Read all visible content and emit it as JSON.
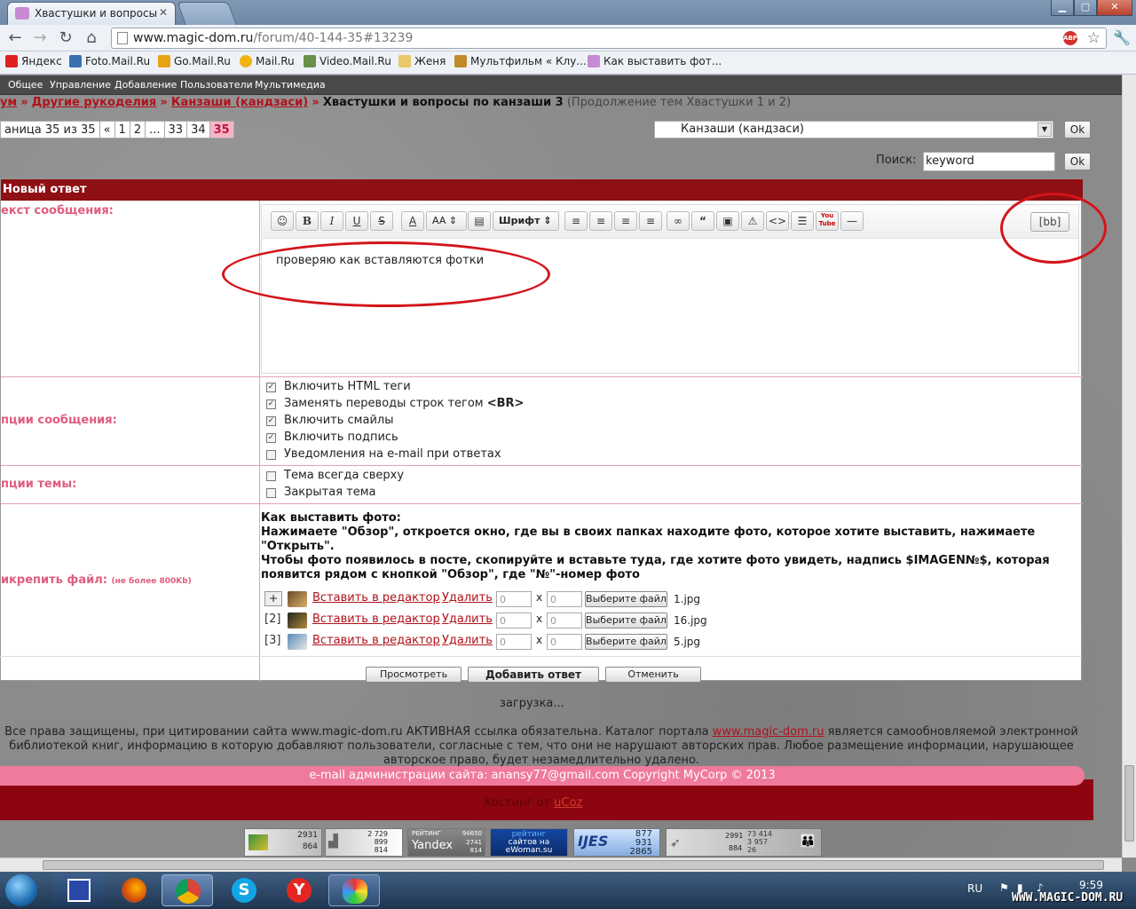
{
  "browser": {
    "tab_title": "Хвастушки и вопросы по",
    "url_host": "www.magic-dom.ru",
    "url_path": "/forum/40-144-35#13239",
    "abp_label": "ABP",
    "bookmarks": [
      "Яндекс",
      "Foto.Mail.Ru",
      "Go.Mail.Ru",
      "Mail.Ru",
      "Video.Mail.Ru",
      "Женя",
      "Мультфильм « Клу...",
      "Как выставить фот..."
    ]
  },
  "site_menu": [
    "Общее",
    "Управление",
    "Добавление",
    "Пользователи",
    "Мультимедиа"
  ],
  "breadcrumb": {
    "l1": "ум",
    "l2": "Другие рукоделия",
    "l3": "Канзаши (кандзаси)",
    "sep": "»",
    "current": "Хвастушки и вопросы по канзаши 3",
    "sub": "(Продолжение тем Хвастушки 1 и 2)"
  },
  "pager": {
    "label": "аница 35 из 35",
    "prev": "«",
    "pages": [
      "1",
      "2",
      "...",
      "33",
      "34"
    ],
    "current": "35"
  },
  "forum_select": {
    "value": "Канзаши (кандзаси)",
    "ok": "Ok"
  },
  "search": {
    "label": "Поиск:",
    "value": "keyword",
    "ok": "Ok"
  },
  "form": {
    "header": "Новый ответ",
    "message_label": "екст сообщения:",
    "toolbar": {
      "bold": "B",
      "italic": "I",
      "underline": "U",
      "strike": "S",
      "font": "Шрифт",
      "size": "AA",
      "bb": "[bb]",
      "youtube": "You Tube"
    },
    "message_text": "проверяю как вставляются фотки",
    "msg_options_label": "пции сообщения:",
    "msg_options": [
      {
        "label": "Включить HTML теги",
        "checked": true
      },
      {
        "label": "Заменять переводы строк тегом <BR>",
        "checked": true
      },
      {
        "label": "Включить смайлы",
        "checked": true
      },
      {
        "label": "Включить подпись",
        "checked": true
      },
      {
        "label": "Уведомления на e-mail при ответах",
        "checked": false
      }
    ],
    "topic_options_label": "пции темы:",
    "topic_options": [
      {
        "label": "Тема всегда сверху",
        "checked": false
      },
      {
        "label": "Закрытая тема",
        "checked": false
      }
    ],
    "attach_label": "икрепить файл:",
    "attach_note": "(не более 800Kb)",
    "howto_title": "Как выставить фото:",
    "howto_text": "Нажимаете \"Обзор\", откроется окно, где вы в своих папках находите фото, которое хотите выставить, нажимаете \"Открыть\".",
    "howto_text2": "Чтобы фото появилось в посте, скопируйте и вставьте туда, где хотите фото увидеть, надпись $IMAGEN№$, которая появится рядом с кнопкой \"Обзор\", где \"№\"-номер фото",
    "files": [
      {
        "idx": "+",
        "insert": "Вставить в редактор",
        "delete": "Удалить",
        "w": "0",
        "h": "0",
        "choose": "Выберите файл",
        "name": "1.jpg"
      },
      {
        "idx": "[2]",
        "insert": "Вставить в редактор",
        "delete": "Удалить",
        "w": "0",
        "h": "0",
        "choose": "Выберите файл",
        "name": "16.jpg"
      },
      {
        "idx": "[3]",
        "insert": "Вставить в редактор",
        "delete": "Удалить",
        "w": "0",
        "h": "0",
        "choose": "Выберите файл",
        "name": "5.jpg"
      }
    ],
    "x_sep": "x",
    "preview": "Просмотреть",
    "submit": "Добавить ответ",
    "cancel": "Отменить"
  },
  "loading": "загрузка...",
  "footer": {
    "copyright_a": "Все права защищены, при цитировании сайта www.magic-dom.ru АКТИВНАЯ ссылка обязательна. Каталог портала",
    "copyright_link": "www.magic-dom.ru",
    "copyright_b": "является самообновляемой электронной библиотекой книг, информацию в которую добавляют пользователи, согласные с тем, что они не нарушают авторских прав. Любое размещение информации, нарушающее авторское право, будет незамедлительно удалено.",
    "email": "e-mail администрации сайта: anansy77@gmail.com Copyright MyCorp © 2013",
    "hosting_label": "Хостинг от",
    "hosting_link": "uCoz"
  },
  "counters": [
    {
      "a": "2931",
      "b": "864"
    },
    {
      "a": "2 729",
      "b": "899",
      "c": "814"
    },
    {
      "a": "РЕЙТИНГ",
      "b": "Yandex",
      "c": "94650",
      "d": "2741",
      "e": "814"
    },
    {
      "a": "рейтинг",
      "b": "сайтов на",
      "c": "eWoman.su"
    },
    {
      "a": "877",
      "b": "931",
      "c": "2865"
    },
    {
      "a": "2991",
      "b": "884",
      "c": "73 414",
      "d": "3 957",
      "e": "26"
    }
  ],
  "taskbar": {
    "lang": "RU",
    "time": "9:59",
    "watermark": "WWW.MAGIC-DOM.RU"
  }
}
